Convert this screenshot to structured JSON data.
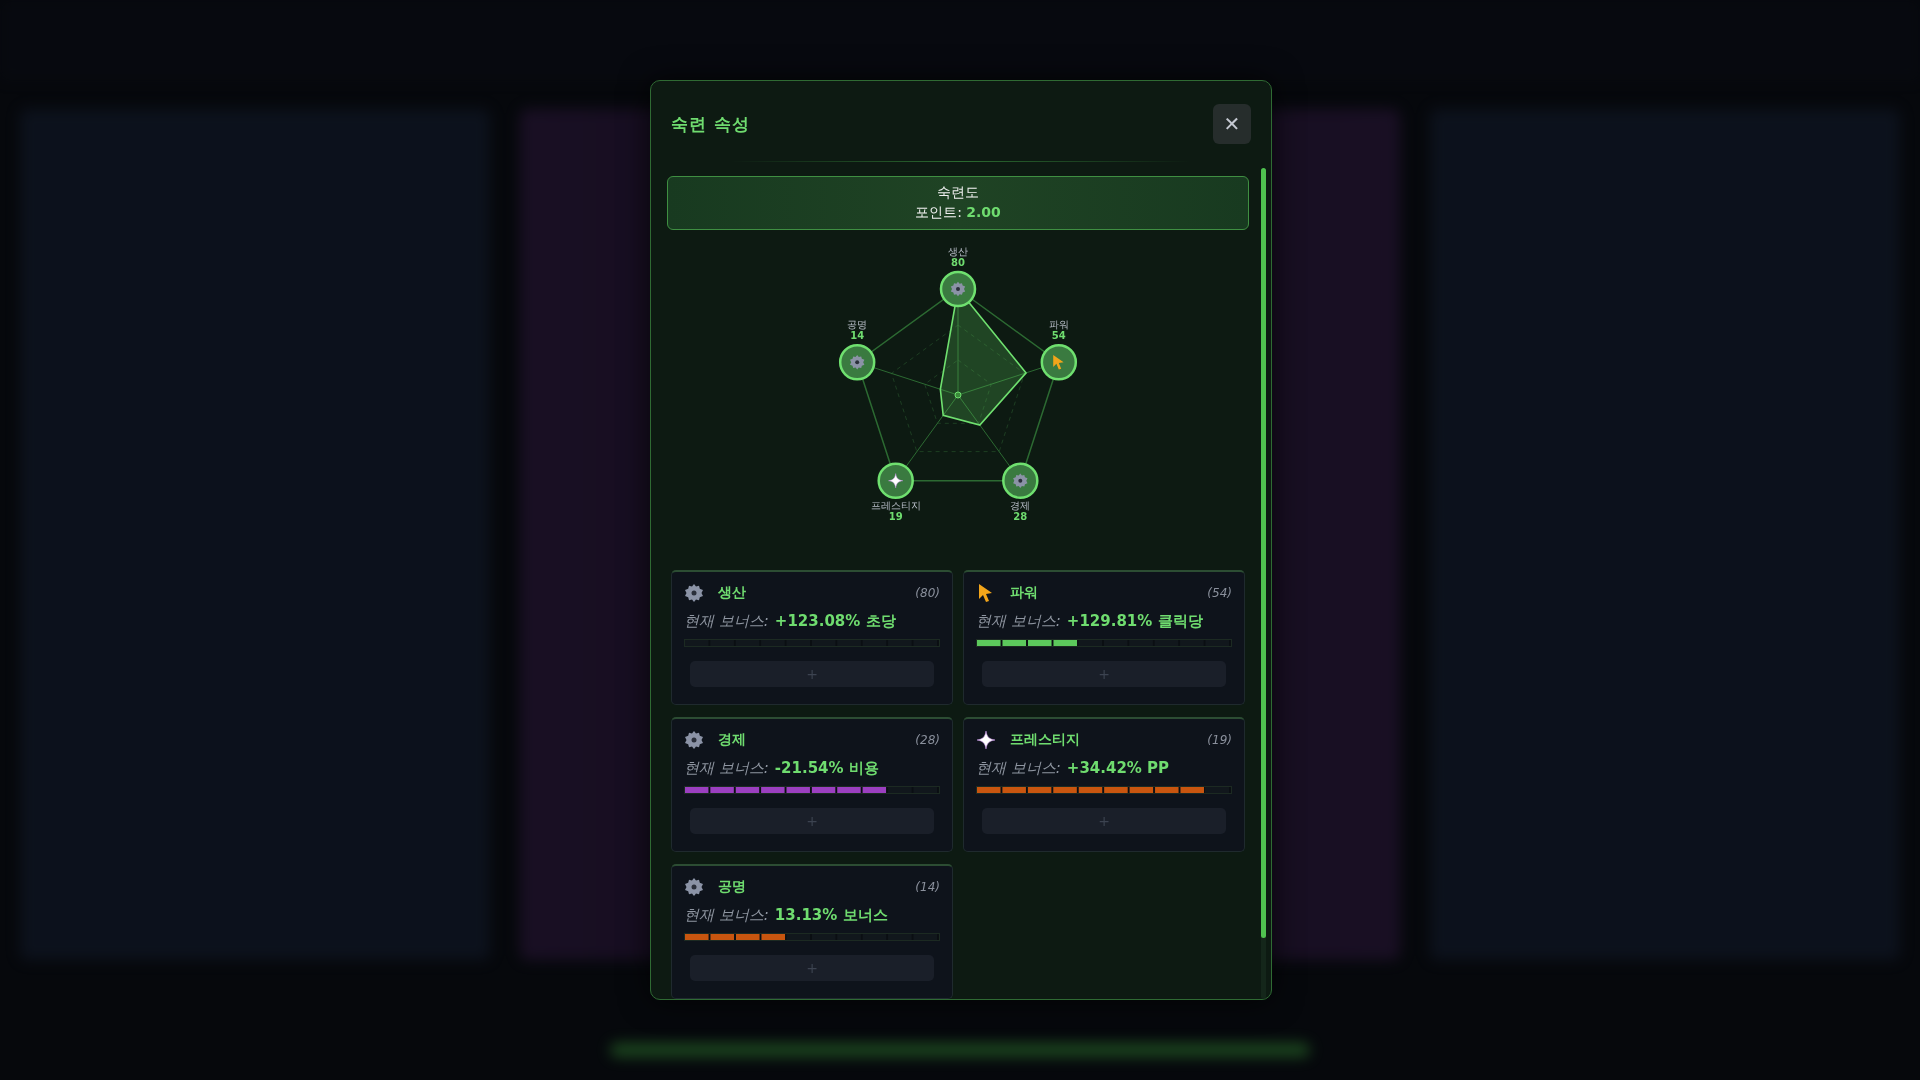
{
  "dialog": {
    "title": "숙련 속성",
    "close": "✕"
  },
  "points": {
    "label": "숙련도",
    "points_label": "포인트:",
    "points_value": "2.00"
  },
  "radar": {
    "axes": [
      {
        "label": "생산",
        "value": "80",
        "kind": "gear"
      },
      {
        "label": "파워",
        "value": "54",
        "kind": "cursor"
      },
      {
        "label": "경제",
        "value": "28",
        "kind": "gear"
      },
      {
        "label": "프레스티지",
        "value": "19",
        "kind": "sparkle"
      },
      {
        "label": "공명",
        "value": "14",
        "kind": "gear"
      }
    ]
  },
  "stats": [
    {
      "name": "생산",
      "count": "(80)",
      "kind": "gear",
      "bonus_label": "현재 보너스:",
      "bonus": "+123.08% 초당",
      "button": "+"
    },
    {
      "name": "파워",
      "count": "(54)",
      "kind": "cursor",
      "bonus_label": "현재 보너스:",
      "bonus": "+129.81% 클릭당",
      "level": 0.4,
      "color": "#5cc95c",
      "button": "+"
    },
    {
      "name": "경제",
      "count": "(28)",
      "kind": "gear",
      "bonus_label": "현재 보너스:",
      "bonus": "-21.54% 비용",
      "level": 0.8,
      "color": "#9b3fc0",
      "button": "+"
    },
    {
      "name": "프레스티지",
      "count": "(19)",
      "kind": "sparkle",
      "bonus_label": "현재 보너스:",
      "bonus": "+34.42% PP",
      "level": 0.9,
      "color": "#c8550f",
      "button": "+"
    },
    {
      "name": "공명",
      "count": "(14)",
      "kind": "gear",
      "bonus_label": "현재 보너스:",
      "bonus": "13.13% 보너스",
      "level": 0.4,
      "color": "#c8550f",
      "button": "+"
    }
  ]
}
